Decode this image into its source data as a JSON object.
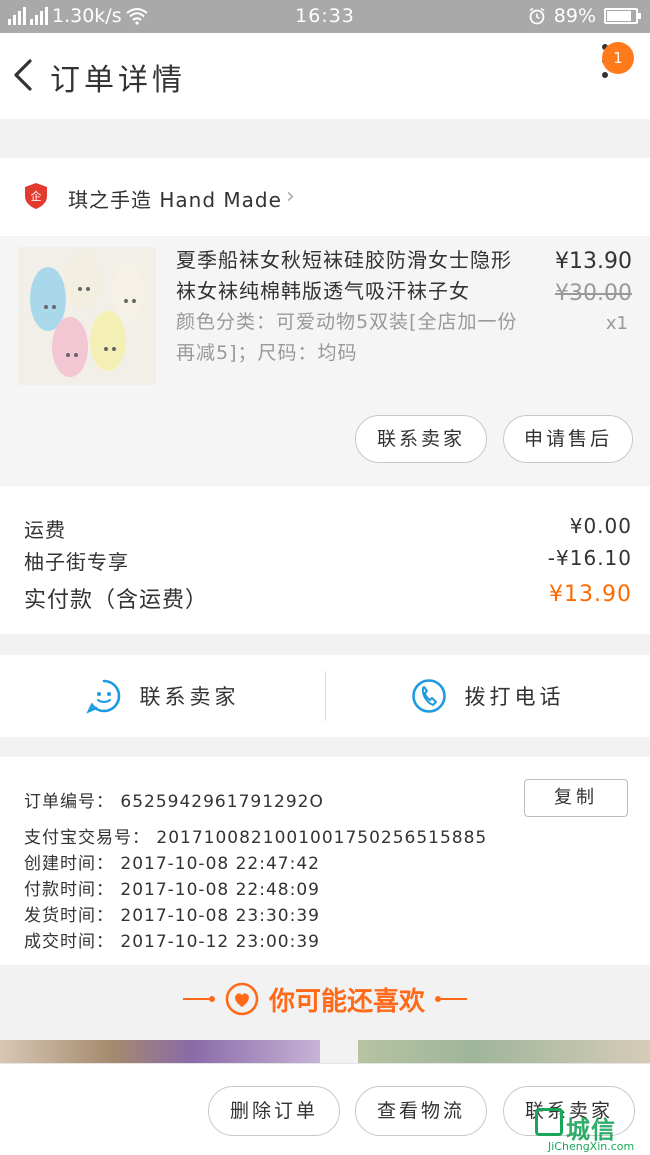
{
  "status_bar": {
    "net_speed": "1.30k/s",
    "time": "16:33",
    "battery": "89%"
  },
  "nav": {
    "title": "订单详情",
    "badge": "1"
  },
  "shop": {
    "name": "琪之手造 Hand Made"
  },
  "product": {
    "title": "夏季船袜女秋短袜硅胶防滑女士隐形袜女袜纯棉韩版透气吸汗袜子女",
    "sku": "颜色分类：可爱动物5双装[全店加一份再减5]；尺码：均码",
    "price": "¥13.90",
    "original_price": "¥30.00",
    "quantity": "x1",
    "buttons": {
      "contact_seller": "联系卖家",
      "after_sale": "申请售后"
    }
  },
  "fees": {
    "shipping_label": "运费",
    "shipping_value": "¥0.00",
    "discount_label": "柚子街专享",
    "discount_value": "-¥16.10",
    "total_label": "实付款（含运费）",
    "total_value": "¥13.90"
  },
  "contact": {
    "seller": "联系卖家",
    "phone": "拨打电话"
  },
  "order_info": {
    "order_no": "订单编号：  6525942961791292O",
    "copy_label": "复制",
    "alipay_no": "支付宝交易号：  2017100821001001750256515885",
    "created": "创建时间：  2017-10-08 22:47:42",
    "paid": "付款时间：  2017-10-08 22:48:09",
    "shipped": "发货时间：  2017-10-08 23:30:39",
    "completed": "成交时间：  2017-10-12 23:00:39"
  },
  "recommend": {
    "title": "你可能还喜欢"
  },
  "bottom_bar": {
    "delete": "删除订单",
    "logistics": "查看物流",
    "contact": "联系卖家"
  },
  "watermark": {
    "text": "城信",
    "sub": "JiChengXin.com"
  },
  "colors": {
    "accent": "#ff6a00",
    "icon_blue": "#1e9be0",
    "shop_red": "#e23a2c"
  }
}
